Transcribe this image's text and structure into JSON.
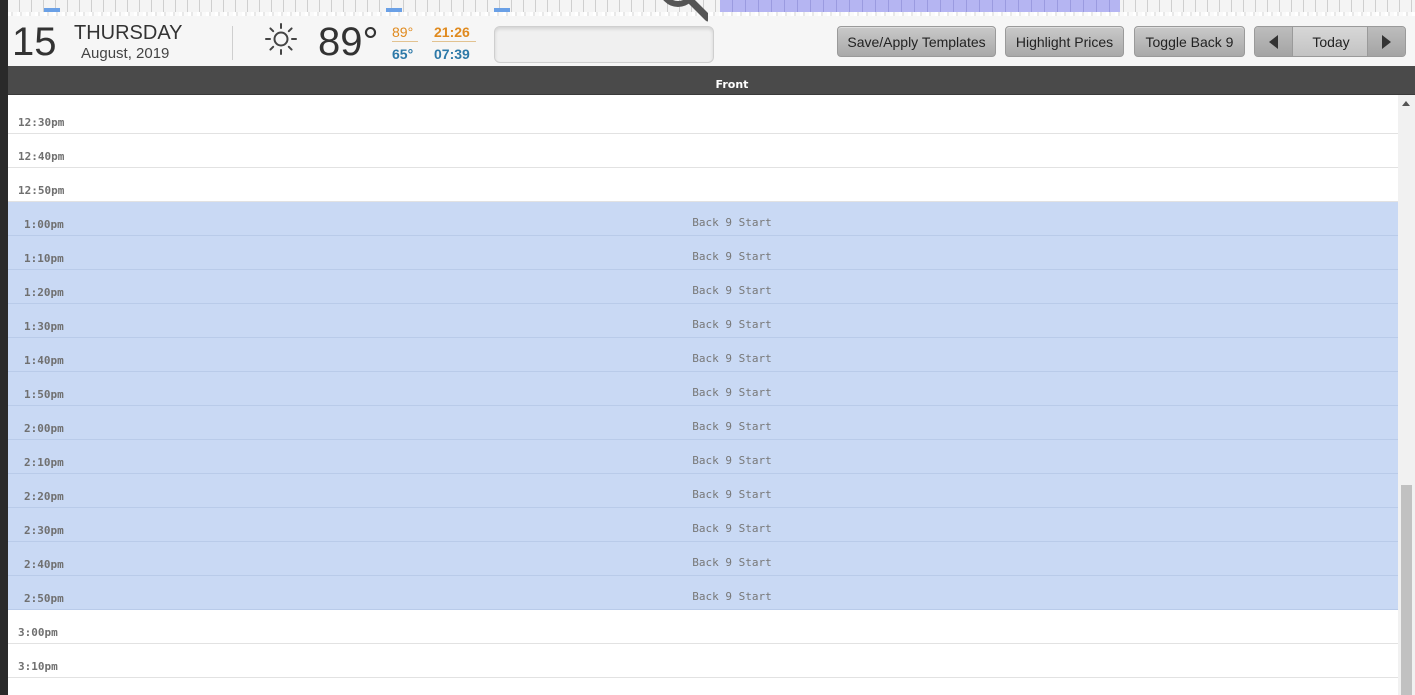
{
  "header": {
    "day": "15",
    "weekday": "THURSDAY",
    "month_year": "August, 2019",
    "weather_icon": "sun-icon",
    "temperature": "89°",
    "high": "89°",
    "low": "65°",
    "sunset": "21:26",
    "sunrise": "07:39",
    "search_value": ""
  },
  "toolbar": {
    "templates_label": "Save/Apply Templates",
    "prices_label": "Highlight Prices",
    "toggle_label": "Toggle Back 9",
    "today_label": "Today"
  },
  "column": {
    "title": "Front"
  },
  "rows": [
    {
      "time": "12:30pm",
      "label": ""
    },
    {
      "time": "12:40pm",
      "label": ""
    },
    {
      "time": "12:50pm",
      "label": ""
    },
    {
      "time": "1:00pm",
      "label": "Back 9 Start"
    },
    {
      "time": "1:10pm",
      "label": "Back 9 Start"
    },
    {
      "time": "1:20pm",
      "label": "Back 9 Start"
    },
    {
      "time": "1:30pm",
      "label": "Back 9 Start"
    },
    {
      "time": "1:40pm",
      "label": "Back 9 Start"
    },
    {
      "time": "1:50pm",
      "label": "Back 9 Start"
    },
    {
      "time": "2:00pm",
      "label": "Back 9 Start"
    },
    {
      "time": "2:10pm",
      "label": "Back 9 Start"
    },
    {
      "time": "2:20pm",
      "label": "Back 9 Start"
    },
    {
      "time": "2:30pm",
      "label": "Back 9 Start"
    },
    {
      "time": "2:40pm",
      "label": "Back 9 Start"
    },
    {
      "time": "2:50pm",
      "label": "Back 9 Start"
    },
    {
      "time": "3:00pm",
      "label": ""
    },
    {
      "time": "3:10pm",
      "label": ""
    }
  ],
  "colors": {
    "back9_shade": "#c9d9f4",
    "high_color": "#e08a1e",
    "low_color": "#2d79a8",
    "header_bar": "#4a4a4a"
  }
}
